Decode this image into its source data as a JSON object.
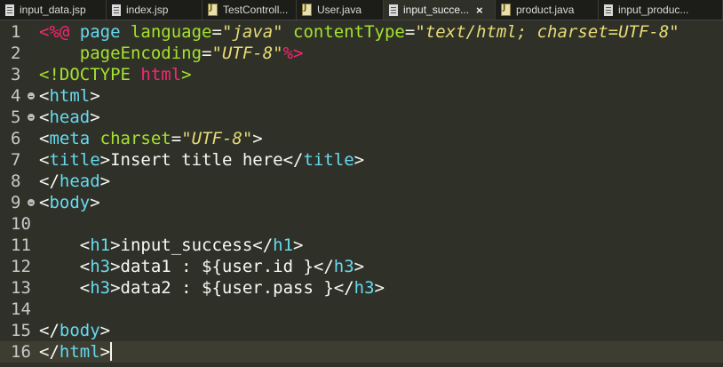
{
  "tabs": [
    {
      "label": "input_data.jsp",
      "type": "jsp",
      "active": false
    },
    {
      "label": "index.jsp",
      "type": "jsp",
      "active": false
    },
    {
      "label": "TestControll...",
      "type": "java",
      "active": false
    },
    {
      "label": "User.java",
      "type": "java",
      "active": false
    },
    {
      "label": "input_succe...",
      "type": "jsp",
      "active": true,
      "close": "×"
    },
    {
      "label": "product.java",
      "type": "java",
      "active": false
    },
    {
      "label": "input_produc...",
      "type": "jsp",
      "active": false
    }
  ],
  "editor": {
    "current_line": 16,
    "lines": [
      {
        "n": "1",
        "fold": false,
        "tokens": [
          [
            "jspd",
            "<%@ "
          ],
          [
            "kw",
            "page "
          ],
          [
            "attr",
            "language"
          ],
          [
            "br",
            "="
          ],
          [
            "str",
            "\"java\""
          ],
          [
            "br",
            " "
          ],
          [
            "attr",
            "contentType"
          ],
          [
            "br",
            "="
          ],
          [
            "str",
            "\"text/html; charset=UTF-8\""
          ]
        ]
      },
      {
        "n": "2",
        "fold": false,
        "tokens": [
          [
            "br",
            "    "
          ],
          [
            "attr",
            "pageEncoding"
          ],
          [
            "br",
            "="
          ],
          [
            "str",
            "\"UTF-8\""
          ],
          [
            "jspd",
            "%>"
          ]
        ]
      },
      {
        "n": "3",
        "fold": false,
        "tokens": [
          [
            "doc",
            "<!DOCTYPE "
          ],
          [
            "ht",
            "html"
          ],
          [
            "doc",
            ">"
          ]
        ]
      },
      {
        "n": "4",
        "fold": true,
        "tokens": [
          [
            "br",
            "<"
          ],
          [
            "tag",
            "html"
          ],
          [
            "br",
            ">"
          ]
        ]
      },
      {
        "n": "5",
        "fold": true,
        "tokens": [
          [
            "br",
            "<"
          ],
          [
            "tag",
            "head"
          ],
          [
            "br",
            ">"
          ]
        ]
      },
      {
        "n": "6",
        "fold": false,
        "tokens": [
          [
            "br",
            "<"
          ],
          [
            "tag",
            "meta "
          ],
          [
            "attr",
            "charset"
          ],
          [
            "br",
            "="
          ],
          [
            "str",
            "\"UTF-8\""
          ],
          [
            "br",
            ">"
          ]
        ]
      },
      {
        "n": "7",
        "fold": false,
        "tokens": [
          [
            "br",
            "<"
          ],
          [
            "tag",
            "title"
          ],
          [
            "br",
            ">"
          ],
          [
            "txt",
            "Insert title here"
          ],
          [
            "br",
            "</"
          ],
          [
            "tag",
            "title"
          ],
          [
            "br",
            ">"
          ]
        ]
      },
      {
        "n": "8",
        "fold": false,
        "tokens": [
          [
            "br",
            "</"
          ],
          [
            "tag",
            "head"
          ],
          [
            "br",
            ">"
          ]
        ]
      },
      {
        "n": "9",
        "fold": true,
        "tokens": [
          [
            "br",
            "<"
          ],
          [
            "tag",
            "body"
          ],
          [
            "br",
            ">"
          ]
        ]
      },
      {
        "n": "10",
        "fold": false,
        "tokens": []
      },
      {
        "n": "11",
        "fold": false,
        "tokens": [
          [
            "br",
            "    <"
          ],
          [
            "tag",
            "h1"
          ],
          [
            "br",
            ">"
          ],
          [
            "txt",
            "input_success"
          ],
          [
            "br",
            "</"
          ],
          [
            "tag",
            "h1"
          ],
          [
            "br",
            ">"
          ]
        ]
      },
      {
        "n": "12",
        "fold": false,
        "tokens": [
          [
            "br",
            "    <"
          ],
          [
            "tag",
            "h3"
          ],
          [
            "br",
            ">"
          ],
          [
            "txt",
            "data1 : ${user.id }"
          ],
          [
            "br",
            "</"
          ],
          [
            "tag",
            "h3"
          ],
          [
            "br",
            ">"
          ]
        ]
      },
      {
        "n": "13",
        "fold": false,
        "tokens": [
          [
            "br",
            "    <"
          ],
          [
            "tag",
            "h3"
          ],
          [
            "br",
            ">"
          ],
          [
            "txt",
            "data2 : ${user.pass }"
          ],
          [
            "br",
            "</"
          ],
          [
            "tag",
            "h3"
          ],
          [
            "br",
            ">"
          ]
        ]
      },
      {
        "n": "14",
        "fold": false,
        "tokens": []
      },
      {
        "n": "15",
        "fold": false,
        "tokens": [
          [
            "br",
            "</"
          ],
          [
            "tag",
            "body"
          ],
          [
            "br",
            ">"
          ]
        ]
      },
      {
        "n": "16",
        "fold": false,
        "tokens": [
          [
            "br",
            "</"
          ],
          [
            "tag",
            "html"
          ],
          [
            "br",
            ">"
          ]
        ]
      }
    ]
  }
}
